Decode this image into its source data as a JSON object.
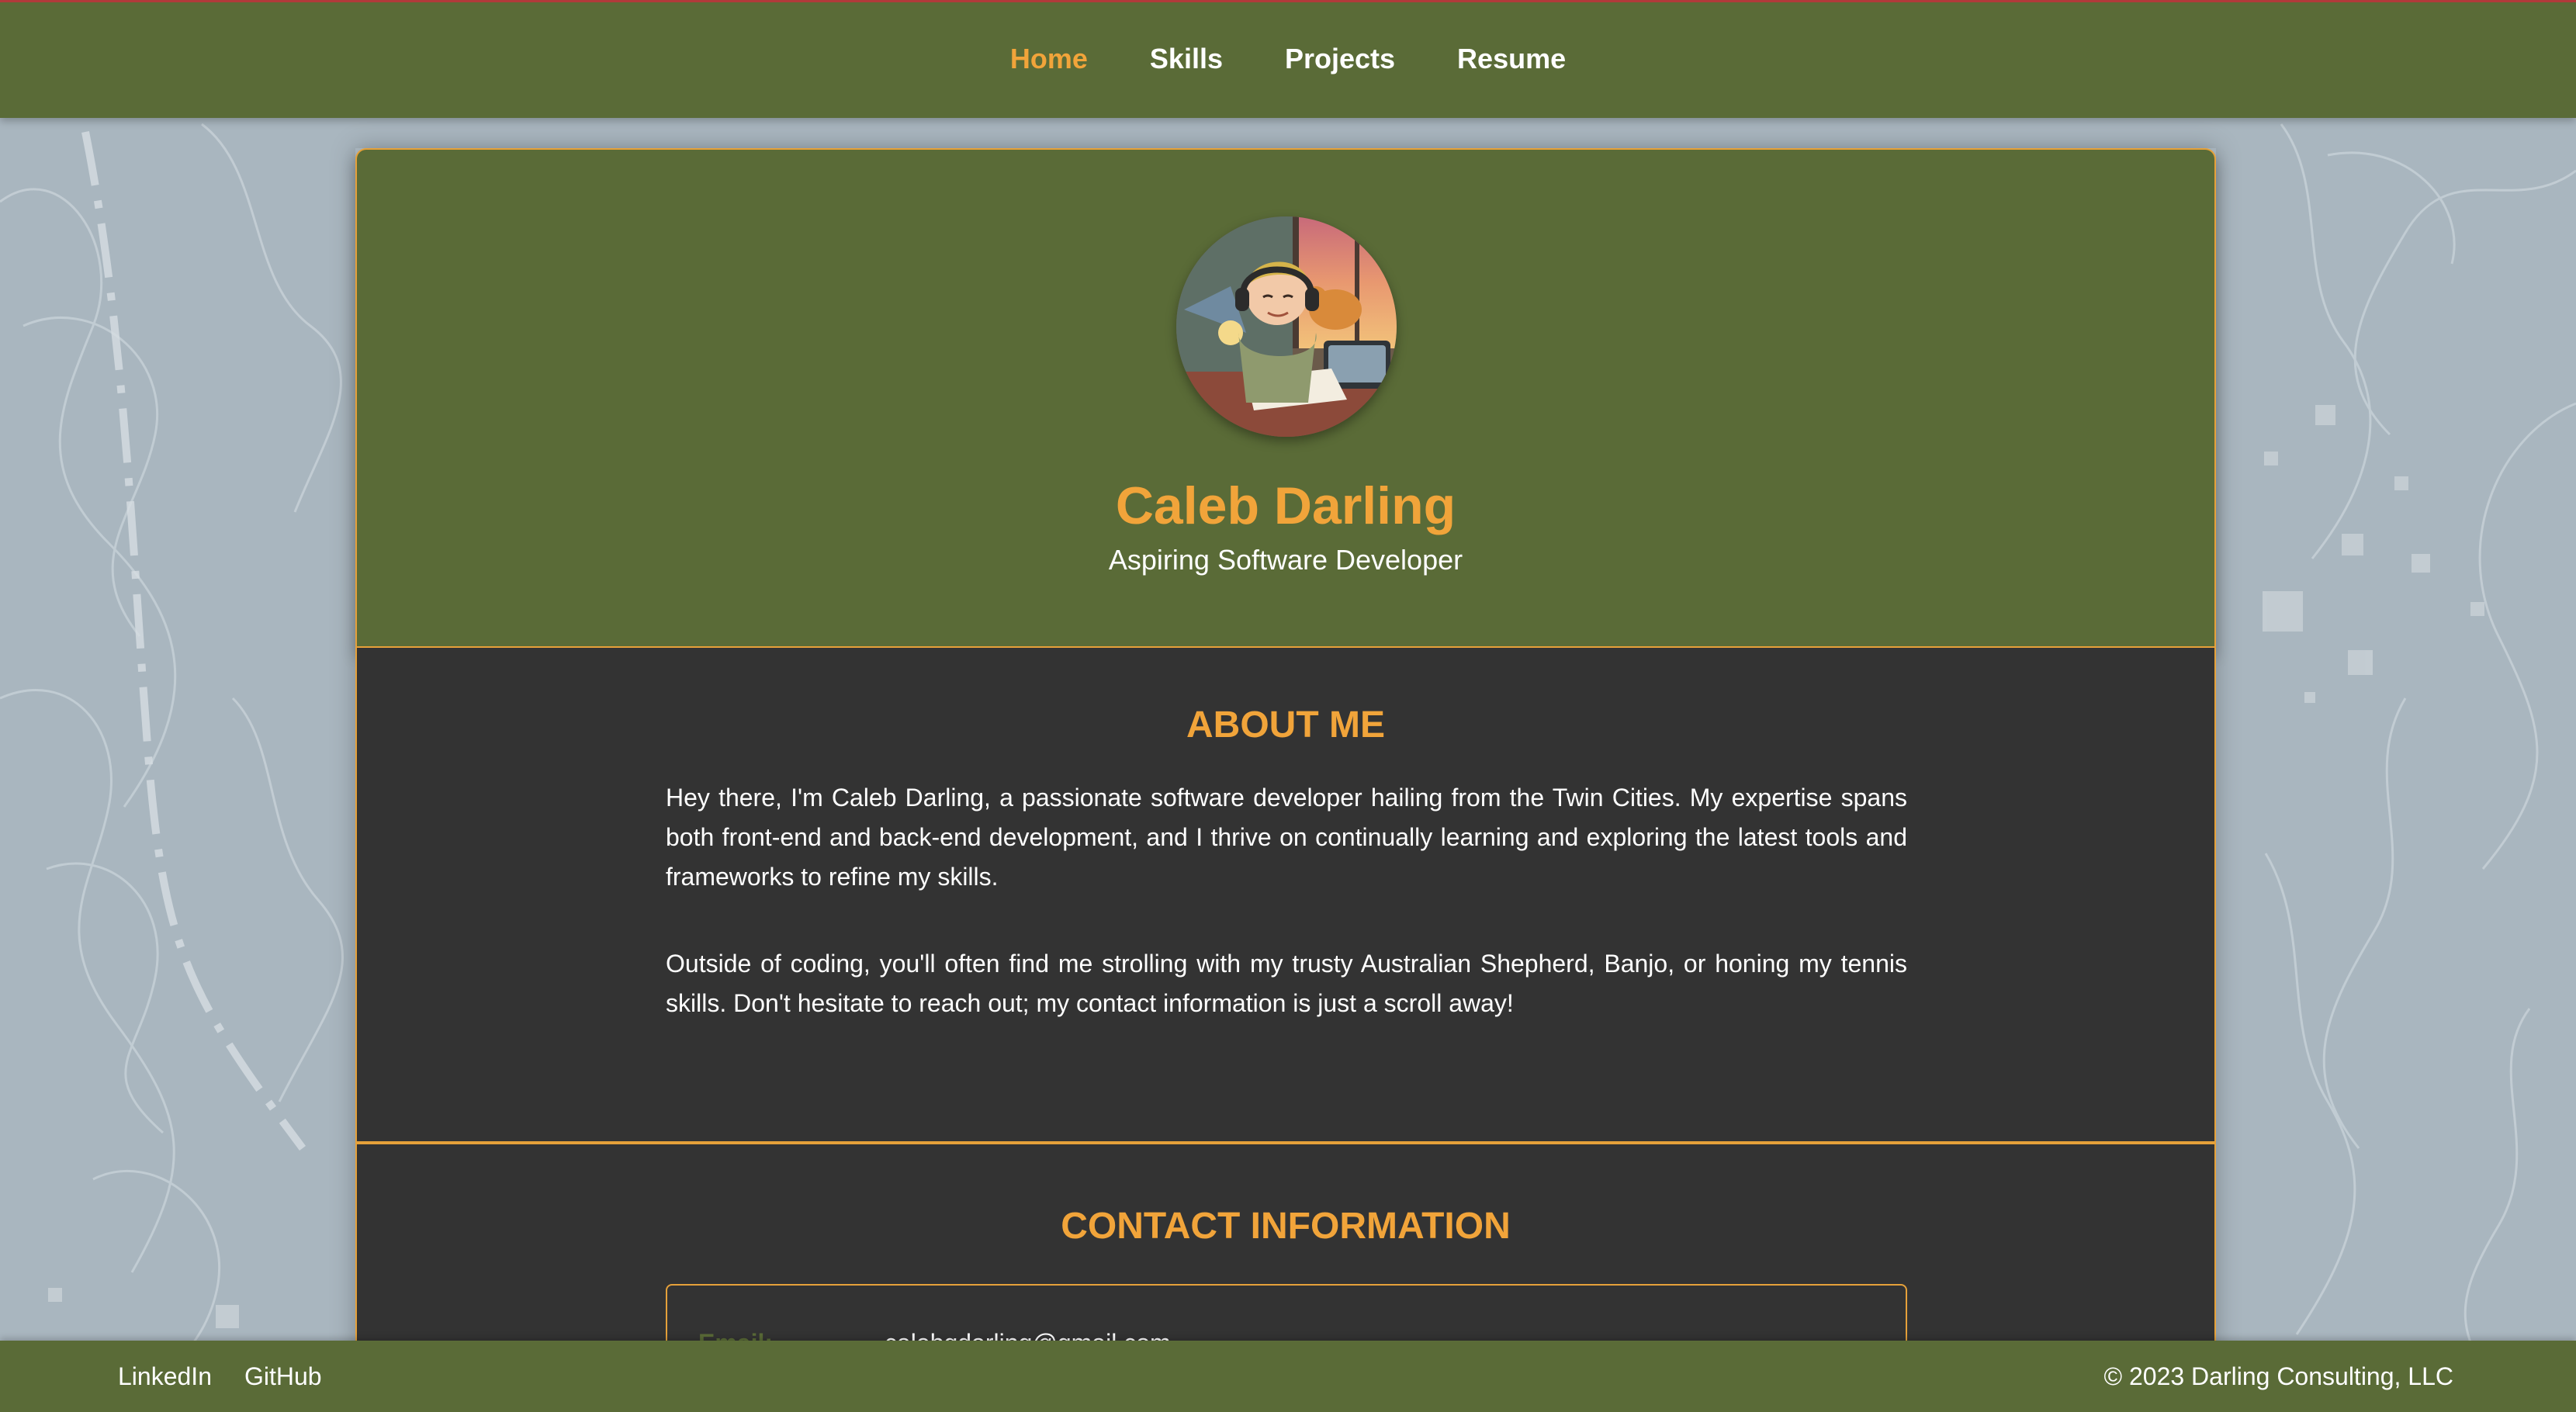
{
  "nav": {
    "items": [
      {
        "label": "Home",
        "active": true
      },
      {
        "label": "Skills",
        "active": false
      },
      {
        "label": "Projects",
        "active": false
      },
      {
        "label": "Resume",
        "active": false
      }
    ]
  },
  "hero": {
    "avatar_icon": "profile-avatar-illustration",
    "name": "Caleb Darling",
    "subtitle": "Aspiring Software Developer"
  },
  "about": {
    "title": "ABOUT ME",
    "paragraphs": [
      "Hey there, I'm Caleb Darling, a passionate software developer hailing from the Twin Cities. My expertise spans both front-end and back-end development, and I thrive on continually learning and exploring the latest tools and frameworks to refine my skills.",
      "Outside of coding, you'll often find me strolling with my trusty Australian Shepherd, Banjo, or honing my tennis skills. Don't hesitate to reach out; my contact information is just a scroll away!"
    ]
  },
  "contact": {
    "title": "CONTACT INFORMATION",
    "email_label": "Email:",
    "email_value": "calebgdarling@gmail.com"
  },
  "footer": {
    "links": [
      "LinkedIn",
      "GitHub"
    ],
    "copyright": "© 2023 Darling Consulting, LLC"
  },
  "colors": {
    "olive": "#5a6b37",
    "accent": "#f1a43a",
    "dark": "#333333",
    "background": "#a9b6bf"
  }
}
